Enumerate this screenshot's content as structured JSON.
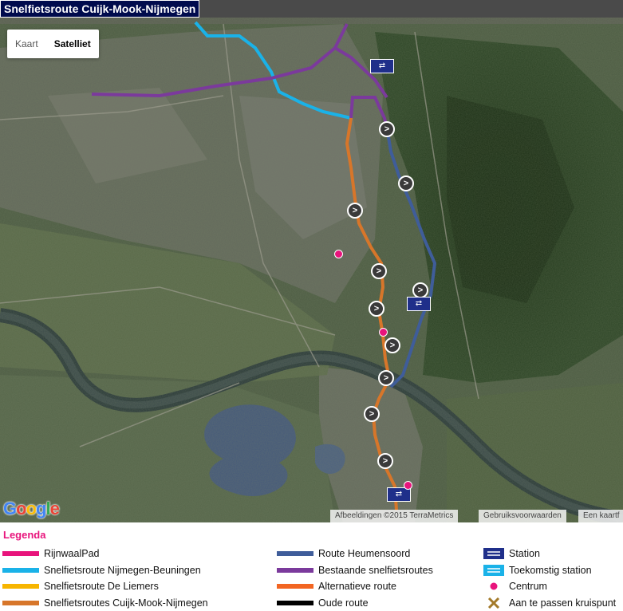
{
  "title": "Snelfietsroute Cuijk-Mook-Nijmegen",
  "map_type": {
    "kaart": "Kaart",
    "satelliet": "Satelliet",
    "selected": "Satelliet"
  },
  "attribution": {
    "imagery": "Afbeeldingen ©2015 TerraMetrics",
    "terms": "Gebruiksvoorwaarden",
    "report": "Een kaartf"
  },
  "logo": "Google",
  "legend": {
    "title": "Legenda",
    "col1": [
      {
        "label": "RijnwaalPad",
        "color": "#e8147c"
      },
      {
        "label": "Snelfietsroute Nijmegen-Beuningen",
        "color": "#1ab2e8"
      },
      {
        "label": "Snelfietsroute De Liemers",
        "color": "#f7b500"
      },
      {
        "label": "Snelfietsroutes Cuijk-Mook-Nijmegen",
        "color": "#d7762a"
      }
    ],
    "col2": [
      {
        "label": "Route Heumensoord",
        "color": "#3f5d9a"
      },
      {
        "label": "Bestaande snelfietsroutes",
        "color": "#7b3a9c"
      },
      {
        "label": "Alternatieve route",
        "color": "#f26522"
      },
      {
        "label": "Oude route",
        "color": "#000000"
      }
    ],
    "col3": [
      {
        "label": "Station",
        "icon": "station-icon"
      },
      {
        "label": "Toekomstig station",
        "icon": "future-station-icon"
      },
      {
        "label": "Centrum",
        "icon": "centrum-icon"
      },
      {
        "label": "Aan te passen kruispunt",
        "icon": "crossing-icon"
      }
    ]
  }
}
